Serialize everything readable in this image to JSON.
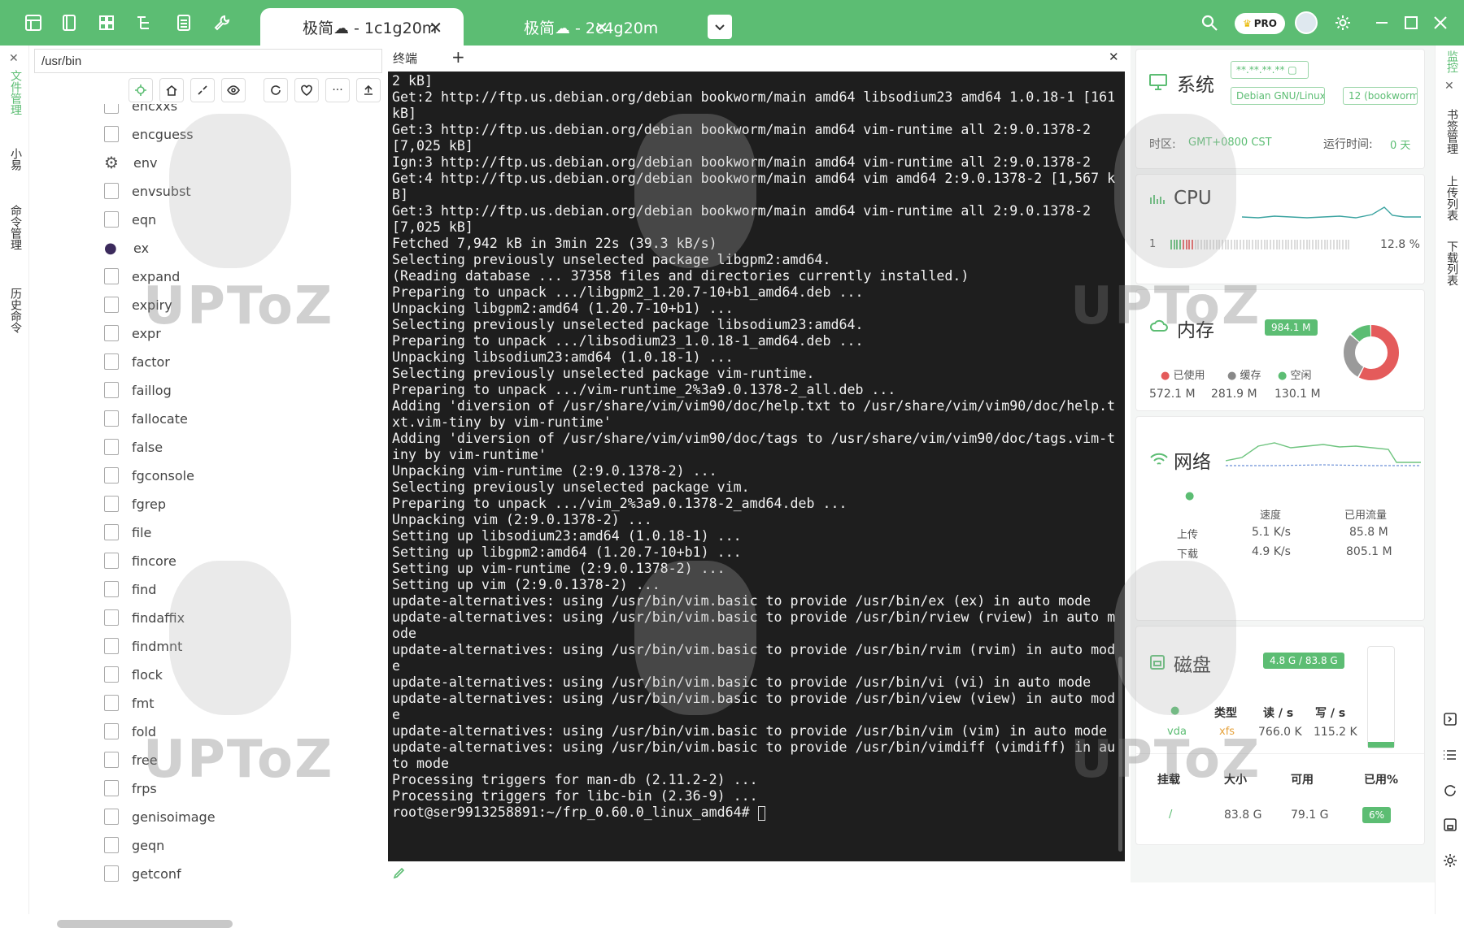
{
  "tabs": [
    {
      "label": "极简☁ - 1c1g20m",
      "active": true
    },
    {
      "label": "极简☁ - 2c4g20m",
      "active": false
    }
  ],
  "title_icons": [
    "grid-icon",
    "notebook-icon",
    "layout-icon",
    "tree-icon",
    "list-icon",
    "wrench-icon"
  ],
  "top_right": {
    "pro_label": "PRO"
  },
  "left_rail": [
    "文件管理",
    "小易",
    "命令管理",
    "历史命令"
  ],
  "file_panel": {
    "path": "/usr/bin",
    "files": [
      "encxxs",
      "encguess",
      "env",
      "envsubst",
      "eqn",
      "ex",
      "expand",
      "expiry",
      "expr",
      "factor",
      "faillog",
      "fallocate",
      "false",
      "fgconsole",
      "fgrep",
      "file",
      "fincore",
      "find",
      "findaffix",
      "findmnt",
      "flock",
      "fmt",
      "fold",
      "free",
      "frps",
      "genisoimage",
      "geqn",
      "getconf"
    ]
  },
  "terminal": {
    "tab_label": "终端",
    "lines": [
      "2 kB]",
      "Get:2 http://ftp.us.debian.org/debian bookworm/main amd64 libsodium23 amd64 1.0.18-1 [161 kB]",
      "Get:3 http://ftp.us.debian.org/debian bookworm/main amd64 vim-runtime all 2:9.0.1378-2 [7,025 kB]",
      "Ign:3 http://ftp.us.debian.org/debian bookworm/main amd64 vim-runtime all 2:9.0.1378-2",
      "Get:4 http://ftp.us.debian.org/debian bookworm/main amd64 vim amd64 2:9.0.1378-2 [1,567 kB]",
      "Get:3 http://ftp.us.debian.org/debian bookworm/main amd64 vim-runtime all 2:9.0.1378-2 [7,025 kB]",
      "Fetched 7,942 kB in 3min 22s (39.3 kB/s)",
      "Selecting previously unselected package libgpm2:amd64.",
      "(Reading database ... 37358 files and directories currently installed.)",
      "Preparing to unpack .../libgpm2_1.20.7-10+b1_amd64.deb ...",
      "Unpacking libgpm2:amd64 (1.20.7-10+b1) ...",
      "Selecting previously unselected package libsodium23:amd64.",
      "Preparing to unpack .../libsodium23_1.0.18-1_amd64.deb ...",
      "Unpacking libsodium23:amd64 (1.0.18-1) ...",
      "Selecting previously unselected package vim-runtime.",
      "Preparing to unpack .../vim-runtime_2%3a9.0.1378-2_all.deb ...",
      "Adding 'diversion of /usr/share/vim/vim90/doc/help.txt to /usr/share/vim/vim90/doc/help.txt.vim-tiny by vim-runtime'",
      "Adding 'diversion of /usr/share/vim/vim90/doc/tags to /usr/share/vim/vim90/doc/tags.vim-tiny by vim-runtime'",
      "Unpacking vim-runtime (2:9.0.1378-2) ...",
      "Selecting previously unselected package vim.",
      "Preparing to unpack .../vim_2%3a9.0.1378-2_amd64.deb ...",
      "Unpacking vim (2:9.0.1378-2) ...",
      "Setting up libsodium23:amd64 (1.0.18-1) ...",
      "Setting up libgpm2:amd64 (1.20.7-10+b1) ...",
      "Setting up vim-runtime (2:9.0.1378-2) ...",
      "Setting up vim (2:9.0.1378-2) ...",
      "update-alternatives: using /usr/bin/vim.basic to provide /usr/bin/ex (ex) in auto mode",
      "update-alternatives: using /usr/bin/vim.basic to provide /usr/bin/rview (rview) in auto mode",
      "update-alternatives: using /usr/bin/vim.basic to provide /usr/bin/rvim (rvim) in auto mode",
      "update-alternatives: using /usr/bin/vim.basic to provide /usr/bin/vi (vi) in auto mode",
      "update-alternatives: using /usr/bin/vim.basic to provide /usr/bin/view (view) in auto mode",
      "update-alternatives: using /usr/bin/vim.basic to provide /usr/bin/vim (vim) in auto mode",
      "update-alternatives: using /usr/bin/vim.basic to provide /usr/bin/vimdiff (vimdiff) in auto mode",
      "Processing triggers for man-db (2.11.2-2) ...",
      "Processing triggers for libc-bin (2.36-9) ...",
      "root@ser9913258891:~/frp_0.60.0_linux_amd64# "
    ]
  },
  "monitor": {
    "system": {
      "title": "系统",
      "ip": "**.**.**.**",
      "os": "Debian GNU/Linux",
      "version": "12 (bookworm)",
      "tz_label": "时区:",
      "tz_value": "GMT+0800  CST",
      "uptime_label": "运行时间:",
      "uptime_value": "0 天"
    },
    "cpu": {
      "title": "CPU",
      "cores": "1",
      "usage": "12.8 %",
      "usage_fraction": 0.128
    },
    "memory": {
      "title": "内存",
      "total": "984.1 M",
      "used_label": "已使用",
      "cache_label": "缓存",
      "free_label": "空闲",
      "used": "572.1 M",
      "cache": "281.9 M",
      "free": "130.1 M"
    },
    "network": {
      "title": "网络",
      "speed_label": "速度",
      "traffic_label": "已用流量",
      "up_label": "上传",
      "down_label": "下载",
      "up_speed": "5.1 K/s",
      "down_speed": "4.9 K/s",
      "up_total": "85.8 M",
      "down_total": "805.1 M"
    },
    "disk": {
      "title": "磁盘",
      "usage": "4.8 G / 83.8 G",
      "type_label": "类型",
      "read_label": "读 / s",
      "write_label": "写 / s",
      "dev": "vda",
      "fs": "xfs",
      "read": "766.0 K",
      "write": "115.2 K",
      "mount_label": "挂载",
      "size_label": "大小",
      "avail_label": "可用",
      "pct_label": "已用%",
      "mount": "/",
      "size": "83.8 G",
      "avail": "79.1 G",
      "pct": "6%"
    }
  },
  "right_rail": [
    "监控",
    "书签管理",
    "上传列表",
    "下载列表"
  ],
  "watermark": "UPToZ",
  "colors": {
    "accent": "#5cbd73",
    "terminal_bg": "#1e1e1e"
  }
}
